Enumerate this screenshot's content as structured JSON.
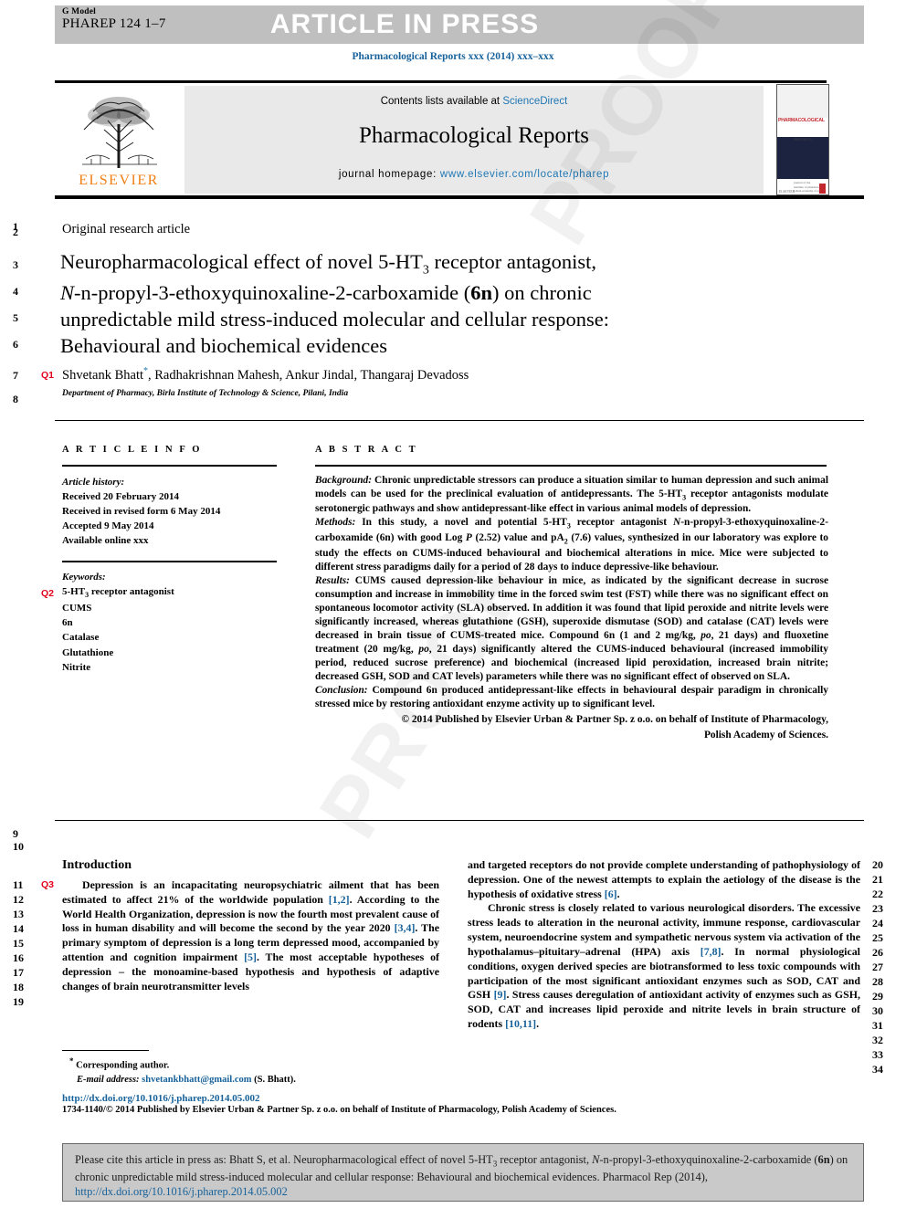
{
  "banner": {
    "g_model_label": "G Model",
    "manuscript_id": "PHAREP 124 1–7",
    "article_in_press": "ARTICLE IN PRESS"
  },
  "running_head": "Pharmacological Reports xxx (2014) xxx–xxx",
  "masthead": {
    "contents_prefix": "Contents lists available at",
    "contents_link": "ScienceDirect",
    "journal_title": "Pharmacological Reports",
    "homepage_prefix": "journal homepage:",
    "homepage_link": "www.elsevier.com/locate/pharep",
    "publisher_logo_word": "ELSEVIER",
    "cover_title": "PHARMACOLOGICAL",
    "cover_subtitle": "REPORTS"
  },
  "article": {
    "kind": "Original research article",
    "title_line1_a": "Neuropharmacological effect of novel 5-HT",
    "title_line1_sub": "3",
    "title_line1_b": " receptor antagonist,",
    "title_line2_italic": "N",
    "title_line2_a": "-n-propyl-3-ethoxyquinoxaline-2-carboxamide (",
    "title_line2_bold": "6n",
    "title_line2_b": ") on chronic",
    "title_line3": "unpredictable mild stress-induced molecular and cellular response:",
    "title_line4": "Behavioural and biochemical evidences",
    "authors": "Shvetank Bhatt",
    "author_star": "*",
    "authors_rest": ", Radhakrishnan Mahesh, Ankur Jindal, Thangaraj Devadoss",
    "affiliation": "Department of Pharmacy, Birla Institute of Technology & Science, Pilani, India"
  },
  "article_info": {
    "heading": "A R T I C L E  I N F O",
    "history_label": "Article history:",
    "history": [
      "Received 20 February 2014",
      "Received in revised form 6 May 2014",
      "Accepted 9 May 2014",
      "Available online xxx"
    ],
    "keywords_label": "Keywords:",
    "keywords": [
      "5-HT3 receptor antagonist",
      "CUMS",
      "6n",
      "Catalase",
      "Glutathione",
      "Nitrite"
    ]
  },
  "abstract": {
    "heading": "A B S T R A C T",
    "background_label": "Background:",
    "background": " Chronic unpredictable stressors can produce a situation similar to human depression and such animal models can be used for the preclinical evaluation of antidepressants. The 5-HT3 receptor antagonists modulate serotonergic pathways and show antidepressant-like effect in various animal models of depression.",
    "methods_label": "Methods:",
    "methods": " In this study, a novel and potential 5-HT3 receptor antagonist N-n-propyl-3-ethoxyquinoxaline-2-carboxamide (6n) with good Log P (2.52) value and pA2 (7.6) values, synthesized in our laboratory was explore to study the effects on CUMS-induced behavioural and biochemical alterations in mice. Mice were subjected to different stress paradigms daily for a period of 28 days to induce depressive-like behaviour.",
    "results_label": "Results:",
    "results": " CUMS caused depression-like behaviour in mice, as indicated by the significant decrease in sucrose consumption and increase in immobility time in the forced swim test (FST) while there was no significant effect on spontaneous locomotor activity (SLA) observed. In addition it was found that lipid peroxide and nitrite levels were significantly increased, whereas glutathione (GSH), superoxide dismutase (SOD) and catalase (CAT) levels were decreased in brain tissue of CUMS-treated mice. Compound 6n (1 and 2 mg/kg, po, 21 days) and fluoxetine treatment (20 mg/kg, po, 21 days) significantly altered the CUMS-induced behavioural (increased immobility period, reduced sucrose preference) and biochemical (increased lipid peroxidation, increased brain nitrite; decreased GSH, SOD and CAT levels) parameters while there was no significant effect of observed on SLA.",
    "conclusion_label": "Conclusion:",
    "conclusion": " Compound 6n produced antidepressant-like effects in behavioural despair paradigm in chronically stressed mice by restoring antioxidant enzyme activity up to significant level.",
    "copyright_line1": "© 2014 Published by Elsevier Urban & Partner Sp. z o.o. on behalf of Institute of Pharmacology,",
    "copyright_line2": "Polish Academy of Sciences."
  },
  "body": {
    "intro_heading": "Introduction",
    "left_paragraph": "Depression is an incapacitating neuropsychiatric ailment that has been estimated to affect 21% of the worldwide population [1,2]. According to the World Health Organization, depression is now the fourth most prevalent cause of loss in human disability and will become the second by the year 2020 [3,4]. The primary symptom of depression is a long term depressed mood, accompanied by attention and cognition impairment [5]. The most acceptable hypotheses of depression – the monoamine-based hypothesis and hypothesis of adaptive changes of brain neurotransmitter levels",
    "right_paragraph_1": "and targeted receptors do not provide complete understanding of pathophysiology of depression. One of the newest attempts to explain the aetiology of the disease is the hypothesis of oxidative stress [6].",
    "right_paragraph_2": "Chronic stress is closely related to various neurological disorders. The excessive stress leads to alteration in the neuronal activity, immune response, cardiovascular system, neuroendocrine system and sympathetic nervous system via activation of the hypothalamus–pituitary–adrenal (HPA) axis [7,8]. In normal physiological conditions, oxygen derived species are biotransformed to less toxic compounds with participation of the most significant antioxidant enzymes such as SOD, CAT and GSH [9]. Stress causes deregulation of antioxidant activity of enzymes such as GSH, SOD, CAT and increases lipid peroxide and nitrite levels in brain structure of rodents [10,11]."
  },
  "footnote": {
    "corresponding_marker": "*",
    "corresponding_text": "Corresponding author.",
    "email_label": "E-mail address:",
    "email": "shvetankbhatt@gmail.com",
    "email_suffix": "(S. Bhatt).",
    "doi": "http://dx.doi.org/10.1016/j.pharep.2014.05.002",
    "issn_line": "1734-1140/© 2014 Published by Elsevier Urban & Partner Sp. z o.o. on behalf of Institute of Pharmacology, Polish Academy of Sciences."
  },
  "citation_box": {
    "prefix": "Please cite this article in press as: Bhatt S, et al. Neuropharmacological effect of novel 5-HT",
    "sub": "3",
    "mid1": " receptor antagonist, ",
    "italic1": "N",
    "mid2": "-n-propyl-3-ethoxyquinoxaline-2-carboxamide (",
    "bold1": "6n",
    "mid3": ") on chronic unpredictable mild stress-induced molecular and cellular response: Behavioural and biochemical evidences. Pharmacol Rep (2014), ",
    "link": "http://dx.doi.org/10.1016/j.pharep.2014.05.002"
  },
  "watermark_text": "PROOF",
  "line_numbers": {
    "left": [
      "1",
      "2",
      "3",
      "4",
      "5",
      "6",
      "7",
      "8",
      "9",
      "10",
      "11",
      "12",
      "13",
      "14",
      "15",
      "16",
      "17",
      "18",
      "19"
    ],
    "right": [
      "20",
      "21",
      "22",
      "23",
      "24",
      "25",
      "26",
      "27",
      "28",
      "29",
      "30",
      "31",
      "32",
      "33",
      "34"
    ]
  },
  "query_tags": {
    "q1": "Q1",
    "q2": "Q2",
    "q3": "Q3"
  },
  "colors": {
    "link": "#17629b",
    "banner": "#bfbfbf",
    "query_red": "#e2001a",
    "elsevier_orange": "#f07f13"
  }
}
